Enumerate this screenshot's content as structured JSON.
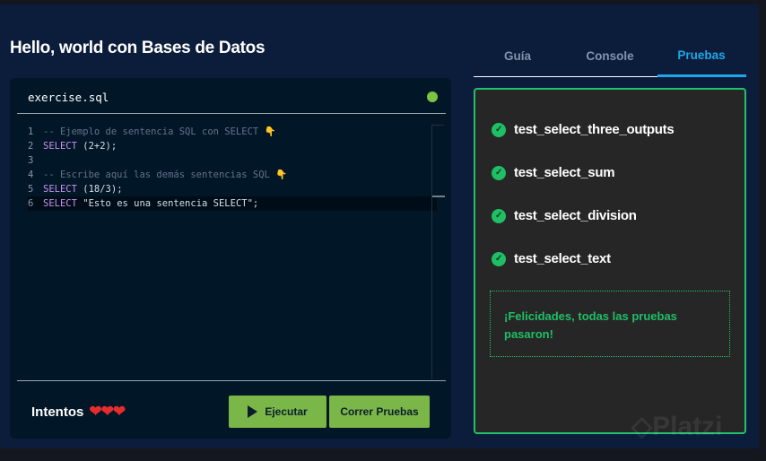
{
  "title": "Hello, world con Bases de Datos",
  "editor": {
    "filename": "exercise.sql",
    "status_color": "#7ec242",
    "lines": [
      {
        "n": "1",
        "parts": [
          {
            "c": "cm",
            "t": "-- Ejemplo de sentencia SQL con SELECT 👇"
          }
        ]
      },
      {
        "n": "2",
        "parts": [
          {
            "c": "kw",
            "t": "SELECT"
          },
          {
            "c": "tx",
            "t": " (2+2);"
          }
        ]
      },
      {
        "n": "3",
        "parts": []
      },
      {
        "n": "4",
        "parts": [
          {
            "c": "cm",
            "t": "-- Escribe aquí las demás sentencias SQL 👇"
          }
        ]
      },
      {
        "n": "5",
        "parts": [
          {
            "c": "kw",
            "t": "SELECT"
          },
          {
            "c": "tx",
            "t": " (18/3);"
          }
        ]
      },
      {
        "n": "6",
        "parts": [
          {
            "c": "kw",
            "t": "SELECT"
          },
          {
            "c": "tx",
            "t": " \"Esto es una sentencia SELECT\";"
          }
        ]
      }
    ]
  },
  "footer": {
    "intentos": "Intentos",
    "hearts": "❤❤❤",
    "lives": 3,
    "run_label": "Ejecutar",
    "tests_label": "Correr Pruebas"
  },
  "tabs": [
    {
      "label": "Guía"
    },
    {
      "label": "Console"
    },
    {
      "label": "Pruebas",
      "active": true
    }
  ],
  "tests": [
    "test_select_three_outputs",
    "test_select_sum",
    "test_select_division",
    "test_select_text"
  ],
  "message": "¡Felicidades, todas las pruebas pasaron!",
  "watermark": "Platzi"
}
